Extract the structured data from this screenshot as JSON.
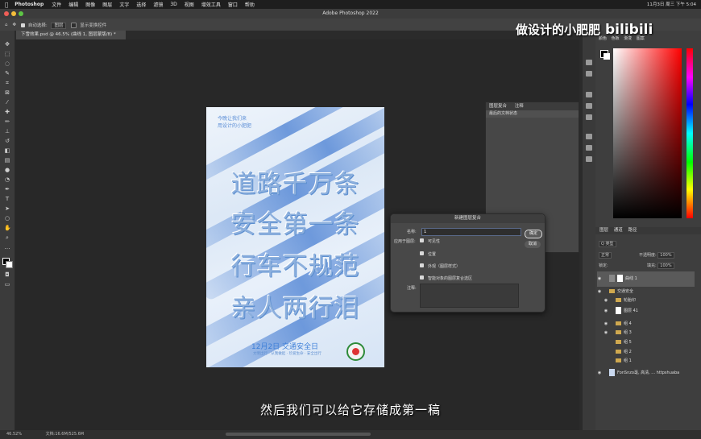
{
  "menubar": {
    "app": "Photoshop",
    "items": [
      "文件",
      "编辑",
      "图像",
      "图层",
      "文字",
      "选择",
      "滤镜",
      "3D",
      "视图",
      "增效工具",
      "窗口",
      "帮助"
    ],
    "clock": "11月3日 周三 下午 5:04"
  },
  "window": {
    "title": "Adobe Photoshop 2022"
  },
  "options": {
    "auto_select_label": "自动选择:",
    "auto_select_value": "图层",
    "show_transform_label": "显示变换控件"
  },
  "document_tab": {
    "label": "下雪效果.psd @ 46.5% (曲线 1, 图层蒙版/8) *"
  },
  "poster": {
    "small_lines": [
      "今晚让我们来",
      "用设计的小肥肥"
    ],
    "lines": [
      "道路千万条",
      "安全第一条",
      "行车不规范",
      "亲人两行泪"
    ],
    "date_line": "12月2日 交通安全日",
    "sub_line": "文明出行  ·  从我做起  ·  珍爱生命  ·  安全出行"
  },
  "history_panel": {
    "tabs": [
      "图层复合",
      "注释"
    ],
    "row": "最后的文档状态"
  },
  "dialog": {
    "title": "新建图层复合",
    "name_label": "名称:",
    "name_value": "1",
    "apply_label": "应用于图层:",
    "checkboxes": [
      "可见性",
      "位置",
      "外观（图层样式）",
      "智能对象的图层复合选区"
    ],
    "comment_label": "注释:",
    "ok": "确定",
    "cancel": "取消"
  },
  "color_panel": {
    "tabs": [
      "颜色",
      "色板",
      "渐变",
      "图案"
    ]
  },
  "layers_panel": {
    "tabs": [
      "图层",
      "通道",
      "路径"
    ],
    "kind_label": "Q 类型",
    "blend_mode": "正常",
    "opacity_label": "不透明度:",
    "opacity_value": "100%",
    "lock_label": "锁定:",
    "fill_label": "填充:",
    "fill_value": "100%",
    "layers": [
      {
        "name": "曲线 1",
        "type": "adjustment"
      },
      {
        "name": "交通安全",
        "type": "group"
      },
      {
        "name": "轮胎印",
        "type": "group"
      },
      {
        "name": "图层 41",
        "type": "pixel"
      },
      {
        "name": "组 4",
        "type": "group"
      },
      {
        "name": "组 3",
        "type": "group"
      },
      {
        "name": "组 5",
        "type": "group"
      },
      {
        "name": "组 2",
        "type": "group"
      },
      {
        "name": "组 1",
        "type": "group"
      },
      {
        "name": "FonSnzo毫, 高清, ... httpshuaba",
        "type": "pixel"
      }
    ]
  },
  "status": {
    "zoom": "46.52%",
    "doc": "文档:16.6M/525.6M"
  },
  "subtitle": "然后我们可以给它存储成第一稿",
  "watermark": {
    "text": "做设计的小肥肥",
    "brand": "bilibili"
  },
  "colors": {
    "menubar": "#1e1e1e",
    "panel": "#3e3e3e",
    "accent_snow": "#3d7fd8"
  }
}
